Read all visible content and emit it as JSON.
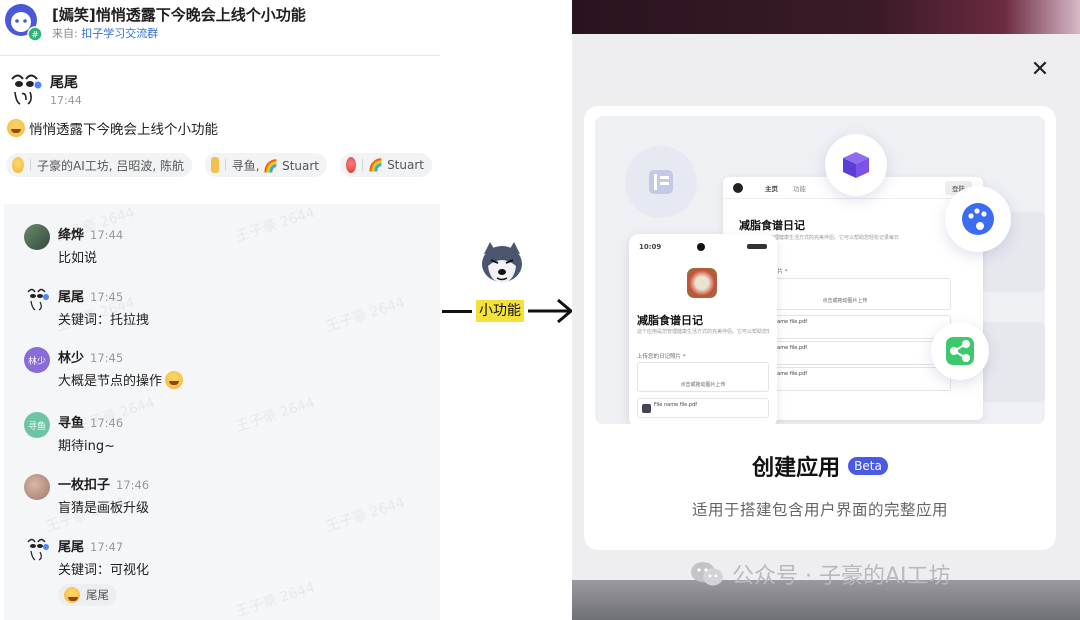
{
  "header": {
    "title": "[嫣笑]悄悄透露下今晚会上线个小功能",
    "source_prefix": "来自:",
    "source_group": "扣子学习交流群"
  },
  "main_message": {
    "sender": "尾尾",
    "time": "17:44",
    "text": "悄悄透露下今晚会上线个小功能"
  },
  "reactions": [
    {
      "users": "子豪的AI工坊, 吕昭波, 陈航"
    },
    {
      "users": "寻鱼, 🌈 Stuart"
    },
    {
      "users": "🌈 Stuart"
    }
  ],
  "thread": [
    {
      "name": "绛烨",
      "time": "17:44",
      "text": "比如说"
    },
    {
      "name": "尾尾",
      "time": "17:45",
      "text": "关键词：托拉拽"
    },
    {
      "name": "林少",
      "avatar_text": "林少",
      "time": "17:45",
      "text": "大概是节点的操作"
    },
    {
      "name": "寻鱼",
      "avatar_text": "寻鱼",
      "time": "17:46",
      "text": "期待ing~"
    },
    {
      "name": "一枚扣子",
      "time": "17:46",
      "text": "盲猜是画板升级"
    },
    {
      "name": "尾尾",
      "time": "17:47",
      "text": "关键词：可视化"
    }
  ],
  "thread_reaction": {
    "users": "尾尾"
  },
  "watermark_text": "王子豪 2644",
  "middle": {
    "label": "小功能"
  },
  "right": {
    "card_title": "创建应用",
    "beta_label": "Beta",
    "card_desc": "适用于搭建包含用户界面的完整应用",
    "footer_watermark": "公众号 · 子豪的AI工坊",
    "preview": {
      "nav_home": "主页",
      "nav_feature": "功能",
      "login": "登陆",
      "app_title": "减脂食谱日记",
      "app_desc": "这个应用是您管理健康生活方式的完美伴侣。它可以帮助您轻松记录每日",
      "upload_label": "上传您的日记照片 *",
      "upload_hint": "点击或拖动图片上传",
      "file_name": "File name file.pdf",
      "phone_time": "10:09"
    },
    "icons": [
      "book-icon",
      "cube-icon",
      "palette-icon",
      "share-icon"
    ]
  },
  "colors": {
    "accent": "#4a5ae8",
    "highlight": "#f5e13c",
    "link": "#2f6fd6"
  }
}
